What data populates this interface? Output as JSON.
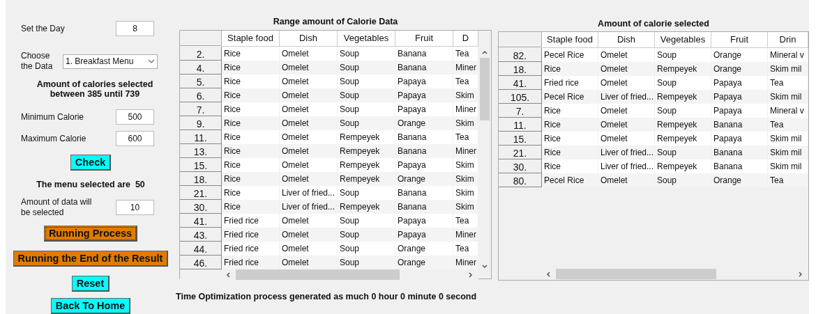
{
  "controls": {
    "day": {
      "label": "Set the Day",
      "value": "8"
    },
    "data_choice": {
      "label": "Choose the Data",
      "value": "1. Breakfast Menu"
    },
    "calorie_range_text": "Amount of calories selected between 385 until 739",
    "minimum": {
      "label": "Minimum Calorie",
      "value": "500"
    },
    "maximum": {
      "label": "Maximum Calorie",
      "value": "600"
    },
    "check_button": {
      "label": "Check",
      "color": "#00ffff",
      "focused": false
    },
    "menu_count_text": "The menu selected are  50",
    "amount": {
      "label": "Amount of data will be selected",
      "value": "10"
    },
    "buttons": [
      {
        "label": "Running Process",
        "color": "#e07b00",
        "focused": true
      },
      {
        "label": "Running the End of the Result",
        "color": "#e07b00",
        "focused": false
      },
      {
        "label": "Reset",
        "color": "#00ffff",
        "focused": false
      },
      {
        "label": "Back To Home",
        "color": "#00ffff",
        "focused": false
      }
    ]
  },
  "tables": [
    {
      "title": "Range amount of Calorie Data",
      "vertical_scrollbar": true,
      "columns": [
        "Staple food",
        "Dish",
        "Vegetables",
        "Fruit",
        "D"
      ],
      "rows": [
        {
          "index": "2.",
          "cells": [
            "Rice",
            "Omelet",
            "Soup",
            "Banana",
            "Tea"
          ]
        },
        {
          "index": "4.",
          "cells": [
            "Rice",
            "Omelet",
            "Soup",
            "Banana",
            "Miner"
          ]
        },
        {
          "index": "5.",
          "cells": [
            "Rice",
            "Omelet",
            "Soup",
            "Papaya",
            "Tea"
          ]
        },
        {
          "index": "6.",
          "cells": [
            "Rice",
            "Omelet",
            "Soup",
            "Papaya",
            "Skim"
          ]
        },
        {
          "index": "7.",
          "cells": [
            "Rice",
            "Omelet",
            "Soup",
            "Papaya",
            "Miner"
          ]
        },
        {
          "index": "9.",
          "cells": [
            "Rice",
            "Omelet",
            "Soup",
            "Orange",
            "Skim"
          ]
        },
        {
          "index": "11.",
          "cells": [
            "Rice",
            "Omelet",
            "Rempeyek",
            "Banana",
            "Tea"
          ]
        },
        {
          "index": "13.",
          "cells": [
            "Rice",
            "Omelet",
            "Rempeyek",
            "Banana",
            "Miner"
          ]
        },
        {
          "index": "15.",
          "cells": [
            "Rice",
            "Omelet",
            "Rempeyek",
            "Papaya",
            "Skim"
          ]
        },
        {
          "index": "18.",
          "cells": [
            "Rice",
            "Omelet",
            "Rempeyek",
            "Orange",
            "Skim"
          ]
        },
        {
          "index": "21.",
          "cells": [
            "Rice",
            "Liver of fried...",
            "Soup",
            "Banana",
            "Skim"
          ]
        },
        {
          "index": "30.",
          "cells": [
            "Rice",
            "Liver of fried...",
            "Rempeyek",
            "Banana",
            "Skim"
          ]
        },
        {
          "index": "41.",
          "cells": [
            "Fried rice",
            "Omelet",
            "Soup",
            "Papaya",
            "Tea"
          ]
        },
        {
          "index": "43.",
          "cells": [
            "Fried rice",
            "Omelet",
            "Soup",
            "Papaya",
            "Miner"
          ]
        },
        {
          "index": "44.",
          "cells": [
            "Fried rice",
            "Omelet",
            "Soup",
            "Orange",
            "Tea"
          ]
        },
        {
          "index": "46.",
          "cells": [
            "Fried rice",
            "Omelet",
            "Soup",
            "Orange",
            "Miner"
          ]
        }
      ]
    },
    {
      "title": "Amount of calorie selected",
      "vertical_scrollbar": false,
      "columns": [
        "Staple food",
        "Dish",
        "Vegetables",
        "Fruit",
        "Drin"
      ],
      "rows": [
        {
          "index": "82.",
          "cells": [
            "Pecel Rice",
            "Omelet",
            "Soup",
            "Orange",
            "Mineral v"
          ]
        },
        {
          "index": "18.",
          "cells": [
            "Rice",
            "Omelet",
            "Rempeyek",
            "Orange",
            "Skim mil"
          ]
        },
        {
          "index": "41.",
          "cells": [
            "Fried rice",
            "Omelet",
            "Soup",
            "Papaya",
            "Tea"
          ]
        },
        {
          "index": "105.",
          "cells": [
            "Pecel Rice",
            "Liver of fried...",
            "Rempeyek",
            "Papaya",
            "Skim mil"
          ]
        },
        {
          "index": "7.",
          "cells": [
            "Rice",
            "Omelet",
            "Soup",
            "Papaya",
            "Mineral v"
          ]
        },
        {
          "index": "11.",
          "cells": [
            "Rice",
            "Omelet",
            "Rempeyek",
            "Banana",
            "Tea"
          ]
        },
        {
          "index": "15.",
          "cells": [
            "Rice",
            "Omelet",
            "Rempeyek",
            "Papaya",
            "Skim mil"
          ]
        },
        {
          "index": "21.",
          "cells": [
            "Rice",
            "Liver of fried...",
            "Soup",
            "Banana",
            "Skim mil"
          ]
        },
        {
          "index": "30.",
          "cells": [
            "Rice",
            "Liver of fried...",
            "Rempeyek",
            "Banana",
            "Skim mil"
          ]
        },
        {
          "index": "80.",
          "cells": [
            "Pecel Rice",
            "Omelet",
            "Soup",
            "Orange",
            "Tea"
          ]
        }
      ]
    }
  ],
  "status_text": "Time Optimization process generated as much 0 hour 0 minute 0 second"
}
